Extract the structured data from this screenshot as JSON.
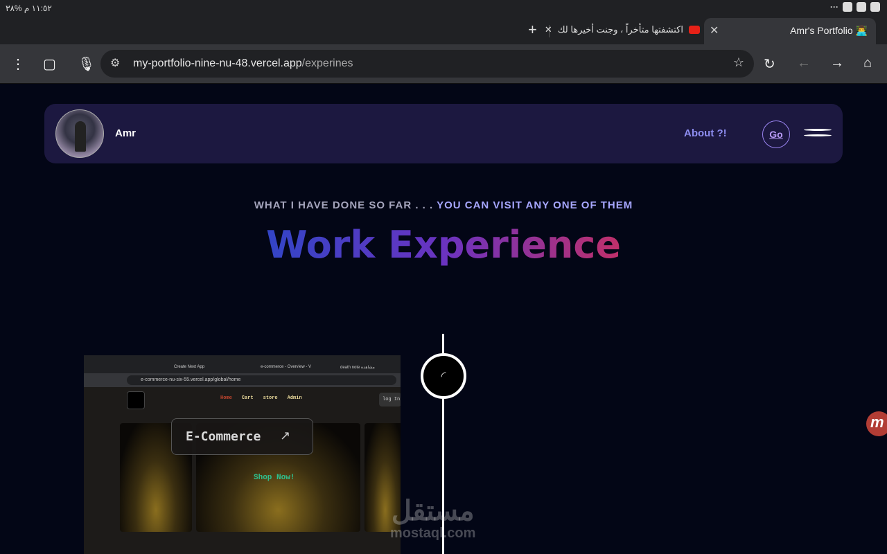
{
  "status_bar": {
    "time": "١١:٥٢ م",
    "battery": "%٣٨"
  },
  "tabs": [
    {
      "title": "Amr's Portfolio 👨‍💻",
      "active": true
    },
    {
      "title": "اكتشفتها متأخراً ، وجنت أخيرها لك"
    }
  ],
  "browser": {
    "url_host": "my-portfolio-nine-nu-48.vercel.app",
    "url_path": "/experines"
  },
  "navbar": {
    "name": "Amr",
    "about": "About ?!",
    "go": "Go"
  },
  "hero": {
    "subtitle_a": "WHAT I HAVE DONE SO FAR . . . ",
    "subtitle_b": "YOU CAN VISIT ANY ONE OF THEM",
    "title": "Work Experience"
  },
  "experience": {
    "card_title": "E-Commerce",
    "screenshot": {
      "tabs": [
        "Create Next App",
        "e-commerce - Overview - V",
        "death note مشاهدة"
      ],
      "url": "e-commerce-nu-six-55.vercel.app/global/home",
      "nav": [
        "Home",
        "Cart",
        "store",
        "Admin"
      ],
      "login": "log In",
      "cta": "Shop Now!"
    }
  },
  "watermark": {
    "arabic": "مستقل",
    "latin": "mostaql.com"
  }
}
